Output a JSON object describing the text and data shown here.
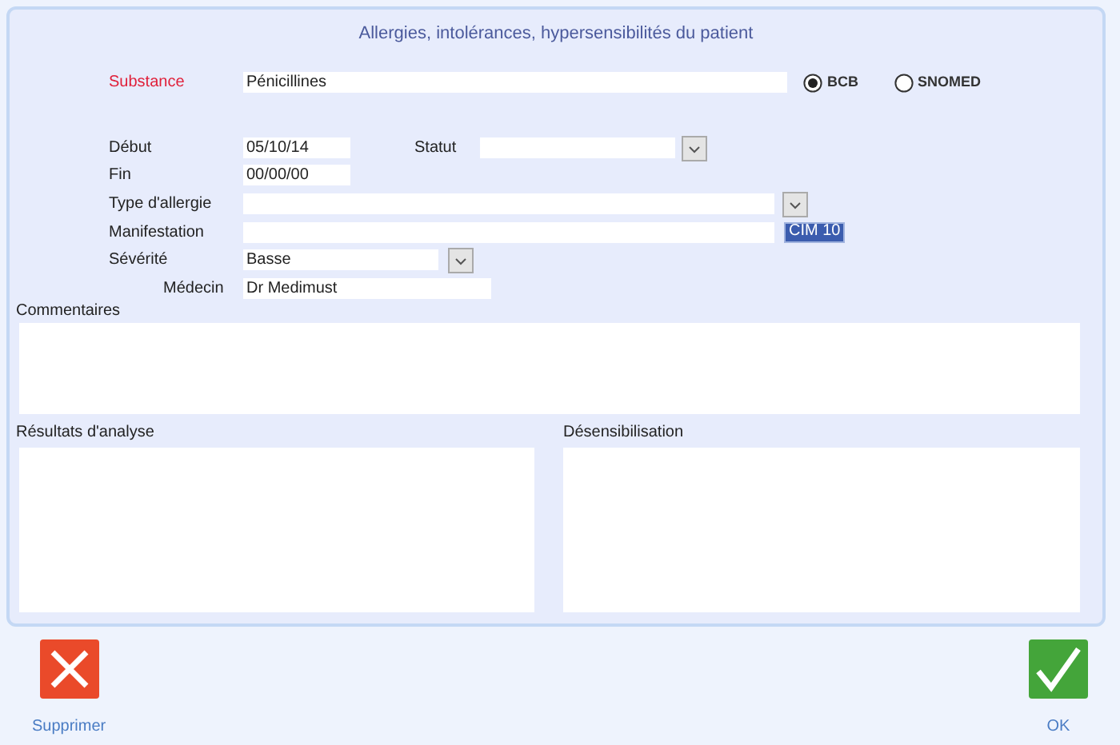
{
  "title": "Allergies, intolérances, hypersensibilités  du patient",
  "substance": {
    "label": "Substance",
    "value": "Pénicillines"
  },
  "code_systems": [
    {
      "label": "BCB",
      "selected": true
    },
    {
      "label": "SNOMED",
      "selected": false
    }
  ],
  "debut": {
    "label": "Début",
    "value": "05/10/14"
  },
  "statut": {
    "label": "Statut"
  },
  "fin": {
    "label": "Fin",
    "value": "00/00/00"
  },
  "type_allergie": {
    "label": "Type d'allergie"
  },
  "manifestation": {
    "label": "Manifestation",
    "button": "CIM 10"
  },
  "severite": {
    "label": "Sévérité",
    "value": "Basse"
  },
  "medecin": {
    "label": "Médecin",
    "value": "Dr Medimust"
  },
  "commentaires": {
    "label": "Commentaires"
  },
  "resultats": {
    "label": "Résultats d'analyse"
  },
  "desensibilisation": {
    "label": "Désensibilisation"
  },
  "buttons": [
    {
      "kind": "delete",
      "label": "Supprimer"
    },
    {
      "kind": "ok",
      "label": "OK"
    }
  ]
}
